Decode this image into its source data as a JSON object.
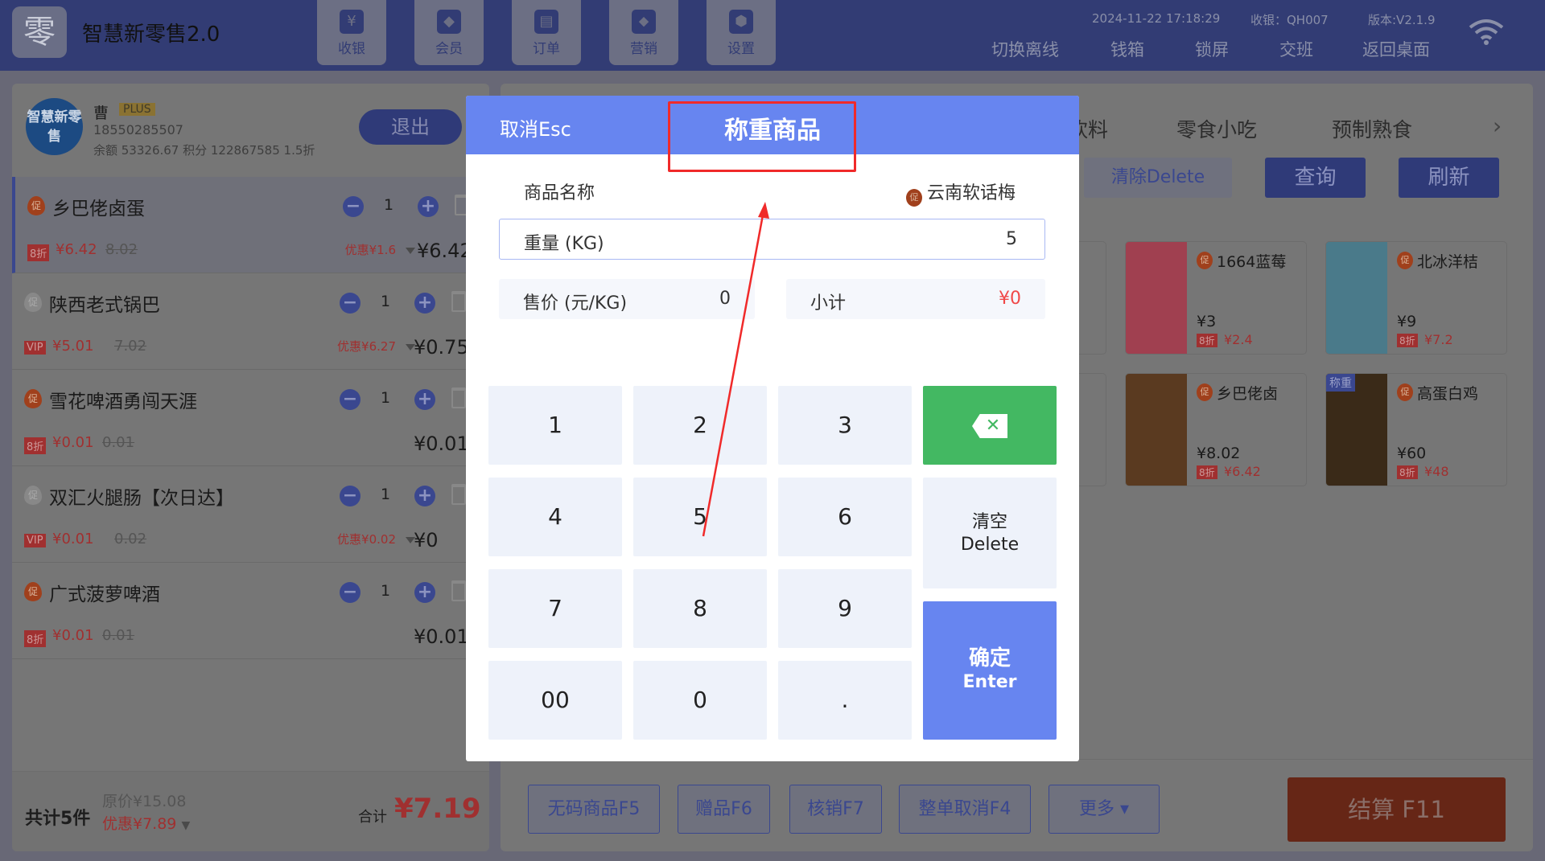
{
  "header": {
    "app_title": "智慧新零售2.0",
    "logo_glyph": "零",
    "nav": [
      {
        "label": "收银",
        "icon": "cash-register-icon",
        "glyph": "¥"
      },
      {
        "label": "会员",
        "icon": "member-icon",
        "glyph": "◆"
      },
      {
        "label": "订单",
        "icon": "order-icon",
        "glyph": "▤"
      },
      {
        "label": "营销",
        "icon": "tag-icon",
        "glyph": "⬥"
      },
      {
        "label": "设置",
        "icon": "settings-icon",
        "glyph": "⬢"
      }
    ],
    "datetime": "2024-11-22 17:18:29",
    "cashier": "收银：QH007",
    "version": "版本:V2.1.9",
    "menu": [
      "切换离线",
      "钱箱",
      "锁屏",
      "交班",
      "返回桌面"
    ]
  },
  "member": {
    "avatar_text": "智慧新零售",
    "name": "曹",
    "badge": "PLUS",
    "phone": "18550285507",
    "balance": "余额 53326.67   积分 122867585   1.5折",
    "logout": "退出"
  },
  "cart": [
    {
      "name": "乡巴佬卤蛋",
      "promo": true,
      "qty": "1",
      "tag": "8折",
      "price": "¥6.42",
      "orig": "8.02",
      "discount": "优惠¥1.6",
      "total": "¥6.42"
    },
    {
      "name": "陕西老式锅巴",
      "promo": false,
      "qty": "1",
      "tag": "VIP",
      "price": "¥5.01",
      "orig": "7.02",
      "discount": "优惠¥6.27",
      "total": "¥0.75"
    },
    {
      "name": "雪花啤酒勇闯天涯",
      "promo": true,
      "qty": "1",
      "tag": "8折",
      "price": "¥0.01",
      "orig": "0.01",
      "discount": "",
      "total": "¥0.01"
    },
    {
      "name": "双汇火腿肠【次日达】",
      "promo": false,
      "qty": "1",
      "tag": "VIP",
      "price": "¥0.01",
      "orig": "0.02",
      "discount": "优惠¥0.02",
      "total": "¥0"
    },
    {
      "name": "广式菠萝啤酒",
      "promo": true,
      "qty": "1",
      "tag": "8折",
      "price": "¥0.01",
      "orig": "0.01",
      "discount": "",
      "total": "¥0.01"
    }
  ],
  "cart_footer": {
    "count": "共计5件",
    "original": "原价¥15.08",
    "discount": "优惠¥7.89",
    "total_label": "合计",
    "total": "¥7.19"
  },
  "categories": [
    "饮料",
    "零食小吃",
    "预制熟食"
  ],
  "search": {
    "clear": "清除Delete",
    "query": "查询",
    "refresh": "刷新"
  },
  "products": [
    {
      "name": "1664蓝莓",
      "price": "¥3",
      "tag": "8折",
      "discount": "¥2.4",
      "img": "#a04050"
    },
    {
      "name": "北冰洋桔",
      "price": "¥9",
      "tag": "8折",
      "discount": "¥7.2",
      "img": "#4a7a8a"
    },
    {
      "name": "乡巴佬卤",
      "price": "¥8.02",
      "tag": "8折",
      "discount": "¥6.42",
      "img": "#5a3a20"
    },
    {
      "name": "高蛋白鸡",
      "price": "¥60",
      "tag": "8折",
      "discount": "¥48",
      "img": "#3a2a18",
      "badge": "称重"
    }
  ],
  "actions": [
    "无码商品F5",
    "赠品F6",
    "核销F7",
    "整单取消F4",
    "更多 ▾"
  ],
  "checkout": "结算 F11",
  "modal": {
    "cancel": "取消Esc",
    "title": "称重商品",
    "product_label": "商品名称",
    "product_name": "云南软话梅",
    "promo_glyph": "促",
    "weight_label": "重量 (KG)",
    "weight_value": "5",
    "price_label": "售价 (元/KG)",
    "price_value": "0",
    "subtotal_label": "小计",
    "subtotal_value": "¥0",
    "keys": [
      "1",
      "2",
      "3",
      "4",
      "5",
      "6",
      "7",
      "8",
      "9",
      "00",
      "0",
      "."
    ],
    "backspace": "✕",
    "clear": "清空",
    "clear_en": "Delete",
    "confirm": "确定",
    "confirm_en": "Enter"
  },
  "colors": {
    "modal_header": "#6785f0",
    "confirm": "#6785f0",
    "backspace": "#43b862",
    "annotation": "#f02a2a"
  }
}
